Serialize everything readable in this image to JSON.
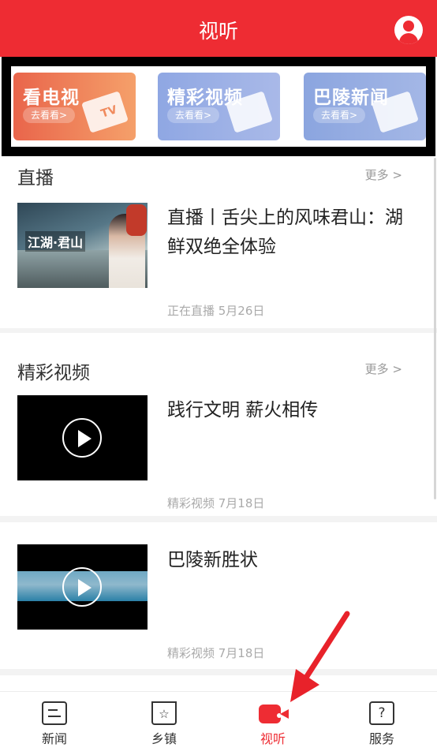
{
  "header": {
    "title": "视听"
  },
  "banner": {
    "cards": [
      {
        "label": "看电视",
        "action": "去看看>",
        "badge": "TV"
      },
      {
        "label": "精彩视频",
        "action": "去看看>",
        "badge": ""
      },
      {
        "label": "巴陵新闻",
        "action": "去看看>",
        "badge": ""
      }
    ]
  },
  "sections": [
    {
      "title": "直播",
      "more": "更多 >"
    },
    {
      "title": "精彩视频",
      "more": "更多 >"
    }
  ],
  "items": [
    {
      "title": "直播丨舌尖上的风味君山：湖鲜双绝全体验",
      "meta": "正在直播  5月26日",
      "thumb_caption": "江湖·君山"
    },
    {
      "title": "践行文明 薪火相传",
      "meta": "精彩视频  7月18日"
    },
    {
      "title": "巴陵新胜状",
      "meta": "精彩视频  7月18日"
    }
  ],
  "tabbar": {
    "tabs": [
      {
        "label": "新闻",
        "icon": "news-icon"
      },
      {
        "label": "乡镇",
        "icon": "town-bookmark-icon"
      },
      {
        "label": "视听",
        "icon": "video-camera-icon",
        "active": true
      },
      {
        "label": "服务",
        "icon": "calendar-question-icon"
      }
    ]
  },
  "colors": {
    "brand": "#ee2c33",
    "annotation_arrow": "#e8222a"
  }
}
